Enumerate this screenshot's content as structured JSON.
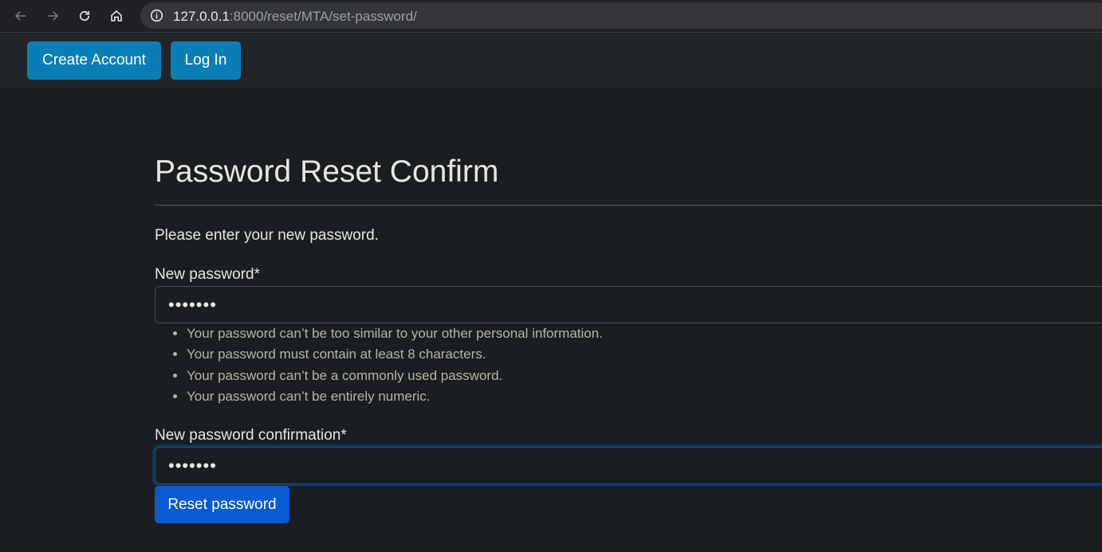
{
  "browser": {
    "url_host": "127.0.0.1",
    "url_rest": ":8000/reset/MTA/set-password/",
    "icons": [
      "back-arrow-icon",
      "forward-arrow-icon",
      "reload-icon",
      "home-icon",
      "info-icon"
    ]
  },
  "nav": {
    "create_account": "Create Account",
    "log_in": "Log In",
    "button_color": "#0a7fb5"
  },
  "page": {
    "title": "Password Reset Confirm",
    "intro": "Please enter your new password."
  },
  "form": {
    "new_password_label": "New password*",
    "new_password_value": "•••••••",
    "help_items": [
      "Your password can’t be too similar to your other personal information.",
      "Your password must contain at least 8 characters.",
      "Your password can’t be a commonly used password.",
      "Your password can’t be entirely numeric."
    ],
    "confirm_label": "New password confirmation*",
    "confirm_value": "•••••••",
    "submit_label": "Reset password",
    "submit_color": "#0a5ad1"
  }
}
